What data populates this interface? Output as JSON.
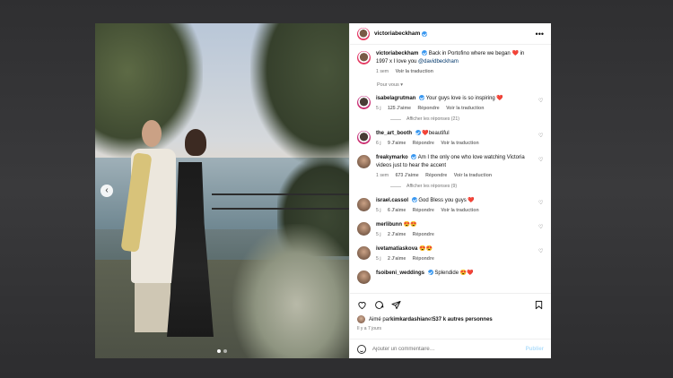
{
  "post": {
    "author": "victoriabeckham",
    "caption_text": "Back in Portofino where we began",
    "caption_heart": "❤️",
    "caption_text2": " in 1997 x I love you ",
    "caption_mention": "@davidbeckham",
    "caption_time": "1 sem",
    "caption_translate": "Voir la traduction",
    "more_icon": "•••"
  },
  "section_label": "Pour vous ▾",
  "comments": [
    {
      "user": "isabelagrutman",
      "verified": true,
      "text": "Your guys love is so inspiring",
      "emoji": "❤️",
      "time": "5 j",
      "likes": "125 J'aime",
      "reply": "Répondre",
      "translate": "Voir la traduction",
      "replies": "Afficher les réponses (21)"
    },
    {
      "user": "the_art_booth",
      "verified": true,
      "text": "beautiful",
      "emoji_prefix": "❤️",
      "time": "6 j",
      "likes": "9 J'aime",
      "reply": "Répondre",
      "translate": "Voir la traduction"
    },
    {
      "user": "freakymarko",
      "verified": true,
      "text": "Am I the only one who love watching Victoria videos just to hear the accent",
      "time": "1 sem",
      "likes": "673 J'aime",
      "reply": "Répondre",
      "translate": "Voir la traduction",
      "replies": "Afficher les réponses (9)"
    },
    {
      "user": "israel.cassol",
      "verified": true,
      "text": "God Bless you guys",
      "emoji": "❤️",
      "time": "5 j",
      "likes": "6 J'aime",
      "reply": "Répondre",
      "translate": "Voir la traduction"
    },
    {
      "user": "merlibunn",
      "verified": false,
      "emoji": "😍😍",
      "time": "5 j",
      "likes": "2 J'aime",
      "reply": "Répondre"
    },
    {
      "user": "ivetamatiaskova",
      "verified": false,
      "emoji": "😍😍",
      "time": "5 j",
      "likes": "2 J'aime",
      "reply": "Répondre"
    },
    {
      "user": "fsoibeni_weddings",
      "verified": true,
      "text": "Splendide",
      "emoji": "😍❤️"
    }
  ],
  "likes": {
    "prefix": "Aimé par ",
    "user": "kimkardashian",
    "middle": " et ",
    "count": "537 k autres personnes"
  },
  "date": "Il y a 7 jours",
  "add_comment": {
    "placeholder": "Ajouter un commentaire…",
    "publish": "Publier"
  },
  "carousel": {
    "prev_icon": "‹",
    "slides": 2,
    "active_slide": 1
  },
  "icons": {
    "like": "heart-icon",
    "comment": "comment-icon",
    "share": "share-icon",
    "save": "bookmark-icon",
    "emoji": "emoji-icon",
    "verified": "verified-badge-icon"
  },
  "colors": {
    "verified": "#3897f0",
    "link": "#00376b",
    "publish_disabled": "#b2dffc"
  }
}
